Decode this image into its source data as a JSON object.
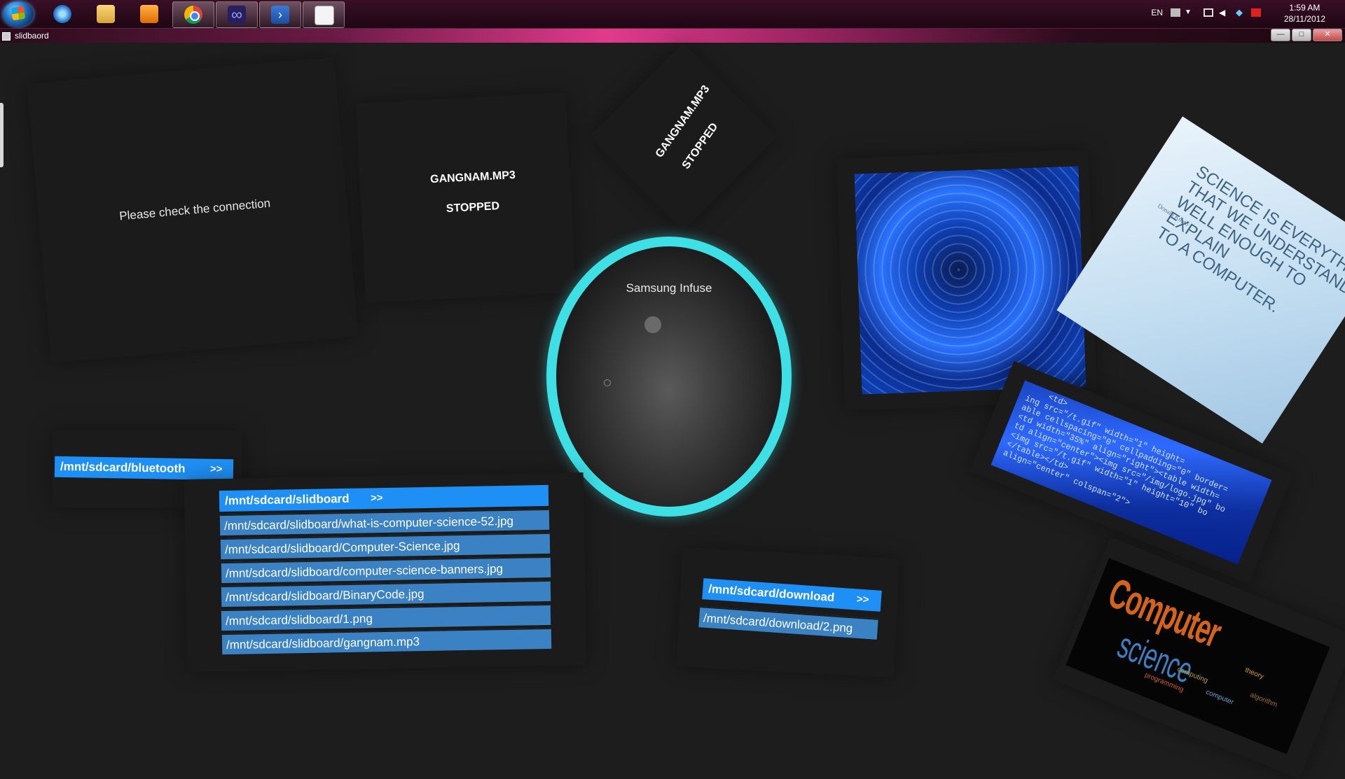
{
  "taskbar": {
    "items": [
      {
        "name": "internet-explorer",
        "icon": "ie-icon"
      },
      {
        "name": "explorer",
        "icon": "folder-icon"
      },
      {
        "name": "media-player",
        "icon": "media-player-icon"
      },
      {
        "name": "chrome",
        "icon": "chrome-icon"
      },
      {
        "name": "app",
        "icon": "infinity-icon"
      },
      {
        "name": "powershell",
        "icon": "powershell-icon"
      },
      {
        "name": "slidboard",
        "icon": "app-icon"
      }
    ],
    "tray": {
      "language": "EN",
      "time": "1:59 AM",
      "date": "28/11/2012"
    }
  },
  "window": {
    "title": "slidbaord",
    "minimize": "—",
    "maximize": "□",
    "close": "✕"
  },
  "tiles": {
    "connection_message": "Please check the connection",
    "song_tile_1": {
      "title": "GANGNAM.MP3",
      "status": "STOPPED"
    },
    "song_tile_2": {
      "title": "GANGNAM.MP3",
      "status": "STOPPED"
    },
    "device": {
      "name": "Samsung Infuse"
    }
  },
  "folders": {
    "bluetooth": {
      "path": "/mnt/sdcard/bluetooth",
      "arrows": ">>"
    },
    "slidboard": {
      "path": "/mnt/sdcard/slidboard",
      "arrows": ">>",
      "files": [
        "/mnt/sdcard/slidboard/what-is-computer-science-52.jpg",
        "/mnt/sdcard/slidboard/Computer-Science.jpg",
        "/mnt/sdcard/slidboard/computer-science-banners.jpg",
        "/mnt/sdcard/slidboard/BinaryCode.jpg",
        "/mnt/sdcard/slidboard/1.png",
        "/mnt/sdcard/slidboard/gangnam.mp3"
      ]
    },
    "download": {
      "path": "/mnt/sdcard/download",
      "arrows": ">>",
      "files": [
        "/mnt/sdcard/download/2.png"
      ]
    }
  },
  "images": {
    "science_quote": {
      "lines": [
        "SCIENCE IS EVERYTHING",
        "THAT WE UNDERSTAND",
        "WELL ENOUGH TO EXPLAIN",
        "TO A COMPUTER."
      ],
      "author": "Donald Knuth"
    },
    "code_lines": [
      "<td>",
      "ing src=\"/t.gif\" width=\"1\" height=",
      "able cellspacing=\"0\" cellpadding=\"0\" border=",
      "<td width=\"35%\" align=\"right\"><table width=",
      "td align=\"center\"><img src=\"/img/logo.jpg\" bo",
      "<img src=\"/t.gif\" width=\"1\" height=\"10\" bo",
      "</table></td>",
      "align=\"center\" colspan=\"2\">"
    ],
    "cs_wordcloud": {
      "big": "Computer",
      "sci": "science",
      "words": [
        "theory",
        "computing",
        "computer",
        "algorithm",
        "programming"
      ]
    }
  }
}
